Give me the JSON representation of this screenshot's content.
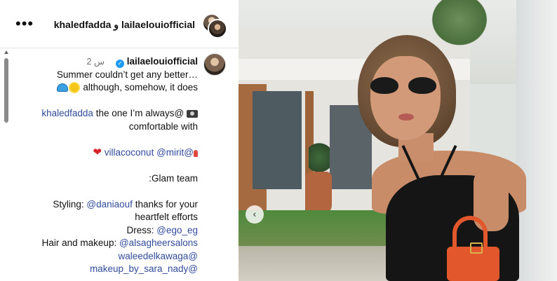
{
  "header": {
    "title": "laila‎elouiofficial و khaledfadda",
    "menu_icon": "more-horizontal-icon"
  },
  "post": {
    "author": "lailaelouiofficial",
    "verified_icon": "verified-badge-icon",
    "time": "2 س",
    "caption": {
      "l1": "Summer couldn’t get any better…",
      "l2": "although, somehow, it does",
      "l3_mention": "khaledfadda",
      "l3_text": "the one I’m always@",
      "l4": "comfortable with",
      "l5_mention": "villacoconut",
      "l5_mention2": "@mirit@",
      "l6": ":Glam team",
      "l7_label": "Styling:",
      "l7_mention": "@daniaouf",
      "l7_text": "thanks for your",
      "l8": "heartfelt efforts",
      "l9_label": "Dress:",
      "l9_mention": "@ego_eg",
      "l10_label": "Hair and makeup:",
      "l10_mention": "@alsagheersalons",
      "l11_mention": "waleedelkawaga@",
      "l12_mention": "makeup_by_sara_nady@"
    }
  },
  "media": {
    "prev_label": "‹",
    "prev_icon": "chevron-left-icon"
  },
  "colors": {
    "mention": "#324b9a",
    "verified": "#1e9bf0",
    "timestamp": "#737373"
  }
}
